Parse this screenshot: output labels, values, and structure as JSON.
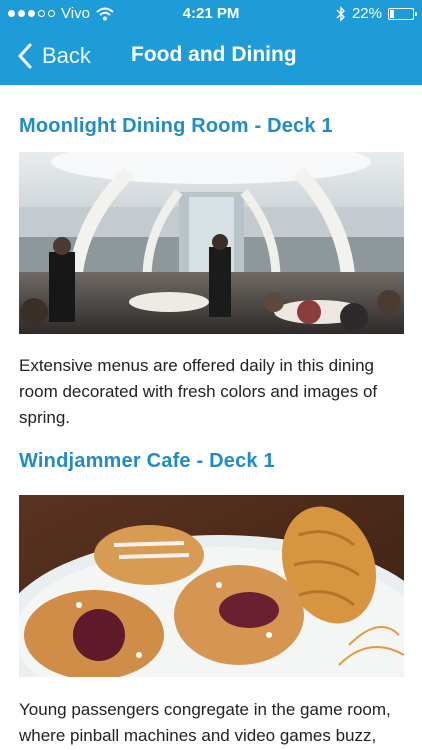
{
  "status_bar": {
    "carrier": "Vivo",
    "time": "4:21 PM",
    "battery": "22%",
    "battery_level": 0.22
  },
  "nav": {
    "back_label": "Back",
    "title": "Food and Dining"
  },
  "sections": [
    {
      "title": "Moonlight Dining Room - Deck 1",
      "description": "Extensive menus are offered daily in this dining room decorated with fresh colors and images of spring."
    },
    {
      "title": "Windjammer Cafe - Deck 1",
      "description": "Young passengers congregate in the game room, where pinball machines and video games buzz,"
    }
  ],
  "colors": {
    "nav_bar": "#1e9cd8",
    "section_title": "#1f8cc8"
  }
}
